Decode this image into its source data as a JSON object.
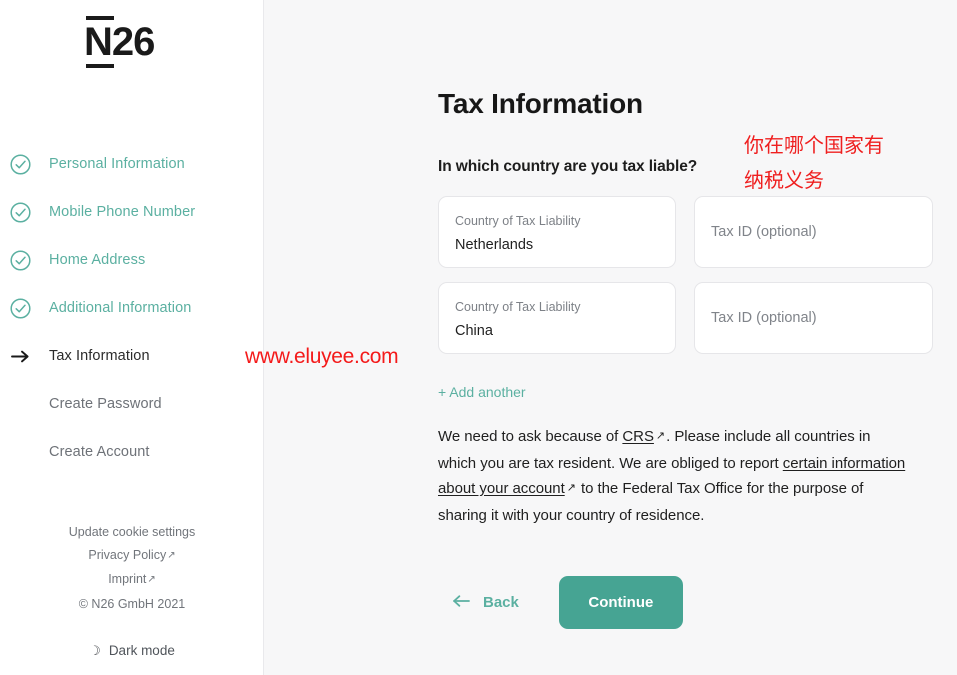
{
  "brand": {
    "logo_text": "N26",
    "accent_color": "#5bb0a1",
    "button_color": "#46a493",
    "annotation_color": "#ef1f1f"
  },
  "sidebar": {
    "steps": [
      {
        "label": "Personal Information",
        "state": "done",
        "icon": "check-circle-icon"
      },
      {
        "label": "Mobile Phone Number",
        "state": "done",
        "icon": "check-circle-icon"
      },
      {
        "label": "Home Address",
        "state": "done",
        "icon": "check-circle-icon"
      },
      {
        "label": "Additional Information",
        "state": "done",
        "icon": "check-circle-icon"
      },
      {
        "label": "Tax Information",
        "state": "current",
        "icon": "arrow-right-icon"
      },
      {
        "label": "Create Password",
        "state": "todo",
        "icon": "none"
      },
      {
        "label": "Create Account",
        "state": "todo",
        "icon": "none"
      }
    ],
    "footer": {
      "cookie_settings": "Update cookie settings",
      "privacy_policy": "Privacy Policy",
      "imprint": "Imprint",
      "external_glyph": "↗",
      "copyright": "© N26 GmbH 2021"
    },
    "dark_mode": {
      "label": "Dark mode",
      "icon": "moon-icon",
      "glyph": "☽"
    }
  },
  "main": {
    "title": "Tax Information",
    "question": "In which country are you tax liable?",
    "annotation_cn": "你在哪个国家有\n纳税义务",
    "watermark": "www.eluyee.com",
    "rows": [
      {
        "country_label": "Country of Tax Liability",
        "country_value": "Netherlands",
        "taxid_placeholder": "Tax ID (optional)",
        "taxid_value": ""
      },
      {
        "country_label": "Country of Tax Liability",
        "country_value": "China",
        "taxid_placeholder": "Tax ID (optional)",
        "taxid_value": ""
      }
    ],
    "add_another": "+ Add another",
    "disclosure": {
      "part1": "We need to ask because of ",
      "link1": "CRS",
      "ext1": "↗",
      "part2": ". Please include all countries in which you are tax resident. We are obliged to report ",
      "link2": "certain information about your account",
      "ext2": "↗",
      "part3": " to the Federal Tax Office for the purpose of sharing it with your country of residence."
    },
    "actions": {
      "back_label": "Back",
      "back_glyph": "←",
      "continue_label": "Continue"
    }
  }
}
